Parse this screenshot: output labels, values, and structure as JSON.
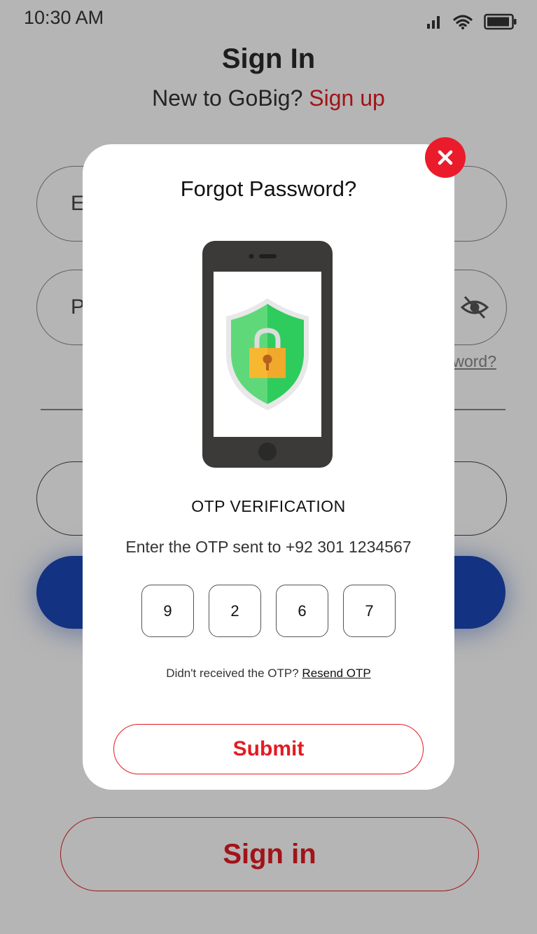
{
  "status_bar": {
    "time": "10:30 AM"
  },
  "header": {
    "title": "Sign In",
    "subtitle_prefix": "New to GoBig?",
    "signup_link": "Sign up"
  },
  "form": {
    "email_partial": "E",
    "password_partial": "P",
    "forgot_partial": "word?"
  },
  "signin_button": "Sign in",
  "modal": {
    "title": "Forgot Password?",
    "otp_heading": "OTP VERIFICATION",
    "instruction": "Enter the OTP sent to +92 301 1234567",
    "otp_digits": [
      "9",
      "2",
      "6",
      "7"
    ],
    "resend_prompt": "Didn't received the OTP?",
    "resend_link": "Resend OTP",
    "submit_label": "Submit"
  },
  "colors": {
    "accent_red": "#e31b23",
    "close_red": "#ea1c2b",
    "brand_blue": "#1c47b8",
    "shield_green": "#2ecc5d"
  },
  "icons": {
    "close": "close-icon",
    "eye": "eye-off-icon",
    "signal": "signal-icon",
    "wifi": "wifi-icon",
    "battery": "battery-icon",
    "illustration": "phone-shield-lock-icon"
  }
}
